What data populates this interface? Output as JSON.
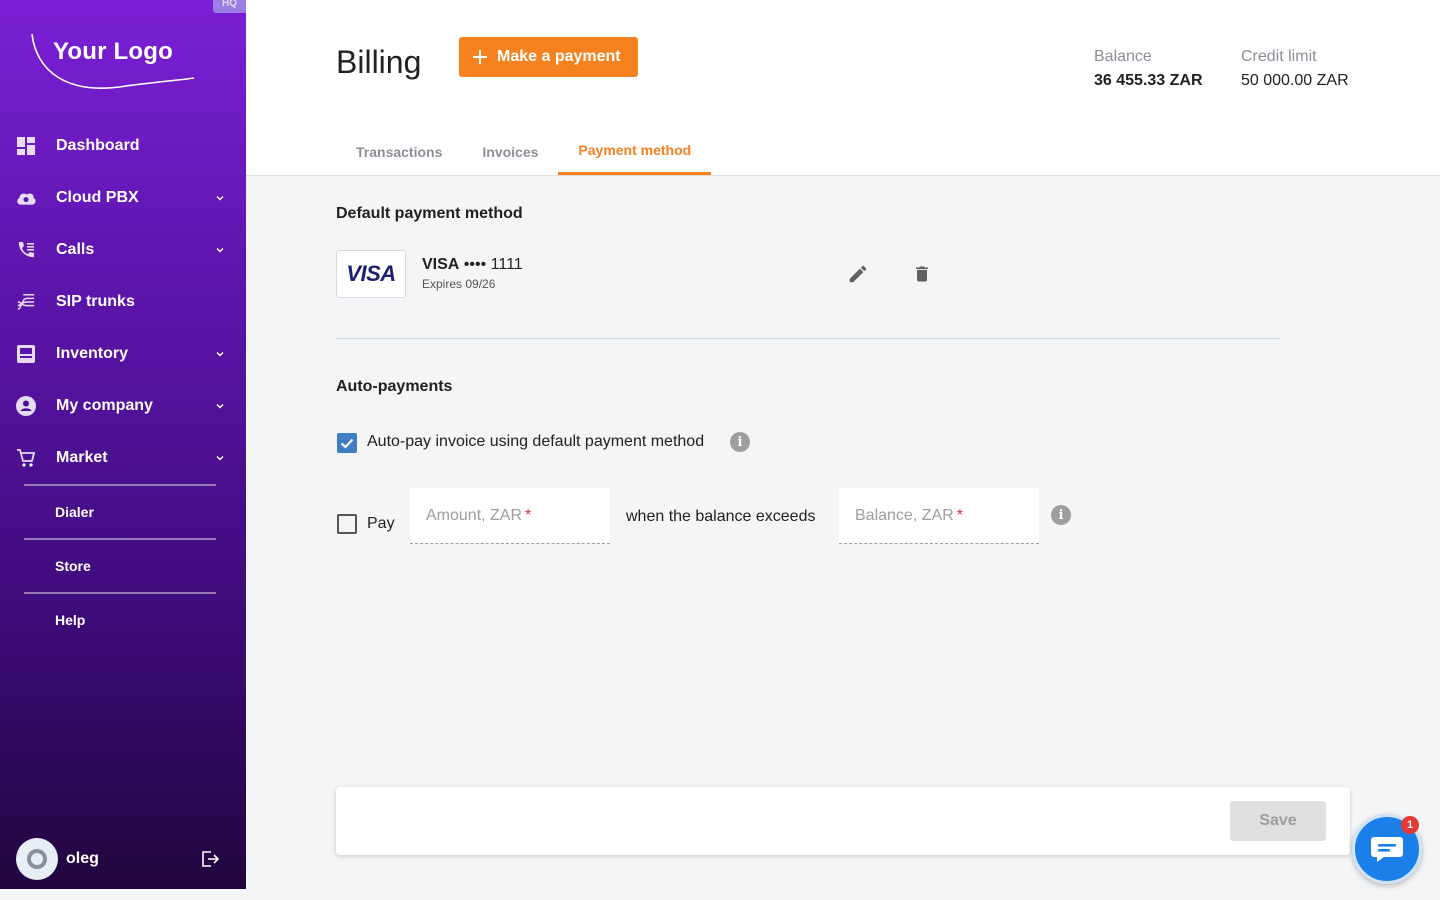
{
  "sidebar": {
    "hq_tag": "HQ",
    "logo_text": "Your Logo",
    "items": [
      {
        "label": "Dashboard",
        "icon": "dashboard-icon"
      },
      {
        "label": "Cloud PBX",
        "icon": "cloud-icon"
      },
      {
        "label": "Calls",
        "icon": "phone-icon"
      },
      {
        "label": "SIP trunks",
        "icon": "sip-trunks-icon"
      },
      {
        "label": "Inventory",
        "icon": "inventory-icon"
      },
      {
        "label": "My company",
        "icon": "company-icon"
      },
      {
        "label": "Market",
        "icon": "cart-icon"
      }
    ],
    "sub_items": [
      {
        "label": "Dialer"
      },
      {
        "label": "Store"
      },
      {
        "label": "Help"
      }
    ],
    "user": {
      "name": "oleg"
    }
  },
  "header": {
    "title": "Billing",
    "make_payment_label": "Make a payment",
    "balance": {
      "caption": "Balance",
      "value": "36 455.33 ZAR"
    },
    "credit_limit": {
      "caption": "Credit limit",
      "value": "50 000.00 ZAR"
    },
    "tabs": [
      {
        "label": "Transactions",
        "active": false
      },
      {
        "label": "Invoices",
        "active": false
      },
      {
        "label": "Payment method",
        "active": true
      }
    ]
  },
  "payment_method": {
    "section_title": "Default payment method",
    "card": {
      "logo_text": "VISA",
      "brand": "VISA",
      "masked": "•••• 1111",
      "expires": "Expires 09/26"
    }
  },
  "auto_payments": {
    "section_title": "Auto-payments",
    "autopay_label": "Auto-pay invoice using default payment method",
    "autopay_checked": true,
    "pay_label": "Pay",
    "pay_checked": false,
    "amount_placeholder": "Amount, ZAR",
    "condition_label": "when the balance exceeds",
    "balance_placeholder": "Balance, ZAR",
    "required_mark": "*"
  },
  "footer": {
    "save_label": "Save"
  },
  "chat": {
    "badge_count": "1"
  },
  "colors": {
    "accent": "#f5821f",
    "checkbox": "#3f7ec4",
    "chat": "#1a7fe8",
    "sidebar_top": "#7b1fd6",
    "sidebar_bottom": "#22053f"
  }
}
